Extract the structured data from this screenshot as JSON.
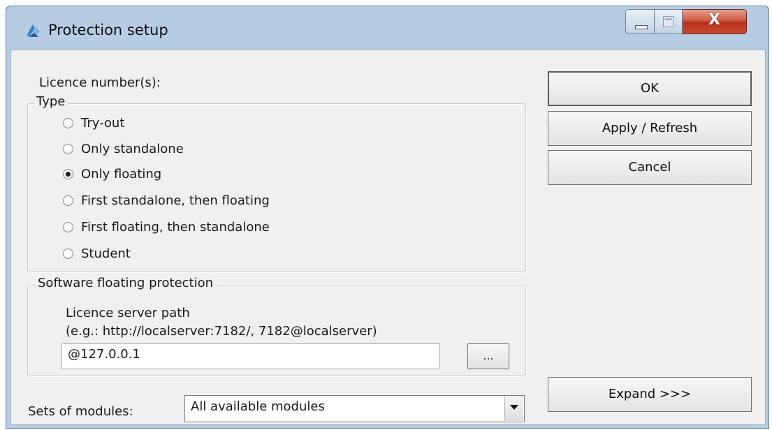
{
  "window": {
    "title": "Protection setup",
    "close_glyph": "X"
  },
  "licence": {
    "label": "Licence number(s):"
  },
  "type_group": {
    "legend": "Type",
    "options": [
      {
        "label": "Try-out",
        "checked": false
      },
      {
        "label": "Only standalone",
        "checked": false
      },
      {
        "label": "Only floating",
        "checked": true
      },
      {
        "label": "First standalone, then floating",
        "checked": false
      },
      {
        "label": "First floating, then standalone",
        "checked": false
      },
      {
        "label": "Student",
        "checked": false
      }
    ]
  },
  "floating_group": {
    "legend": "Software floating protection",
    "path_label": "Licence server path",
    "path_hint": "(e.g.: http://localserver:7182/, 7182@localserver)",
    "path_value": "@127.0.0.1",
    "browse_label": "..."
  },
  "modules": {
    "label": "Sets of modules:",
    "selected": "All available modules"
  },
  "buttons": {
    "ok": "OK",
    "apply": "Apply / Refresh",
    "cancel": "Cancel",
    "expand": "Expand >>>"
  },
  "colors": {
    "frame": "#b7cde3",
    "client": "#f0f0f0",
    "close_button": "#c84b36"
  }
}
